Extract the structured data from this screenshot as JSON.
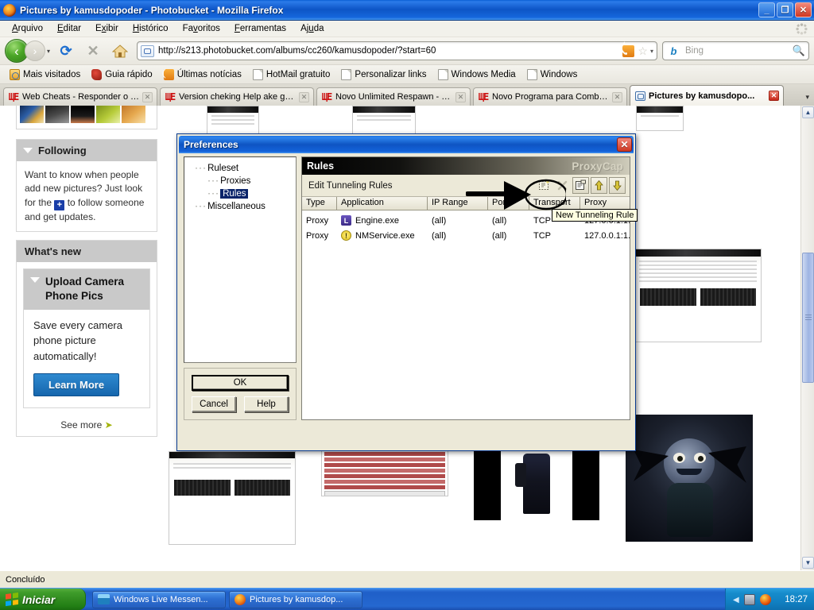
{
  "browser": {
    "window_title": "Pictures by kamusdopoder - Photobucket - Mozilla Firefox",
    "icon": "firefox-icon",
    "window_buttons": {
      "minimize": "_",
      "maximize": "❐",
      "close": "✕"
    },
    "menu": [
      {
        "label": "Arquivo",
        "accel": "A"
      },
      {
        "label": "Editar",
        "accel": "E"
      },
      {
        "label": "Exibir",
        "accel": "x"
      },
      {
        "label": "Histórico",
        "accel": "H"
      },
      {
        "label": "Favoritos",
        "accel": "v"
      },
      {
        "label": "Ferramentas",
        "accel": "F"
      },
      {
        "label": "Ajuda",
        "accel": "u"
      }
    ],
    "toolbar": {
      "back": "‹",
      "forward": "›",
      "history_caret": "▾",
      "reload": "⟳",
      "stop": "✕",
      "home": "home-icon",
      "url": "http://s213.photobucket.com/albums/cc260/kamusdopoder/?start=60",
      "rss": "rss-icon",
      "star": "☆",
      "bookmark_caret": "▾",
      "search_engine": "b",
      "search_placeholder": "Bing",
      "search_value": "",
      "search_icon": "magnifier-icon"
    },
    "bookmarks": [
      {
        "label": "Mais visitados",
        "icon": "folder-search-icon"
      },
      {
        "label": "Guia rápido",
        "icon": "red-bookmark-icon"
      },
      {
        "label": "Últimas notícias",
        "icon": "rss-icon"
      },
      {
        "label": "HotMail gratuito",
        "icon": "page-icon"
      },
      {
        "label": "Personalizar links",
        "icon": "page-icon"
      },
      {
        "label": "Windows Media",
        "icon": "page-icon"
      },
      {
        "label": "Windows",
        "icon": "page-icon"
      }
    ],
    "tabs": [
      {
        "label": "Web Cheats - Responder o T...",
        "icon": "wc-icon",
        "active": false
      },
      {
        "label": "Version cheking Help ake gen...",
        "icon": "wc-icon",
        "active": false
      },
      {
        "label": "Novo Unlimited Respawn - W...",
        "icon": "wc-icon",
        "active": false
      },
      {
        "label": "Novo Programa para Combat...",
        "icon": "wc-icon",
        "active": false
      },
      {
        "label": "Pictures by kamusdopo...",
        "icon": "photobucket-icon",
        "active": true
      }
    ],
    "tab_close_glyph": "✕",
    "tabs_overflow_caret": "▾",
    "status_text": "Concluído",
    "scrollbar": {
      "up": "▲",
      "down": "▼"
    }
  },
  "page": {
    "following": {
      "header": "Following",
      "collapse_icon": "triangle-down-icon",
      "body_before": "Want to know when people add new pictures? Just look for the",
      "badge": "+",
      "body_after": "to follow someone and get updates."
    },
    "whats_new": {
      "header": "What's new",
      "card_title": "Upload Camera Phone Pics",
      "collapse_icon": "triangle-down-icon",
      "card_text": "Save every camera phone picture automatically!",
      "cta": "Learn More",
      "see_more": "See more",
      "see_more_icon": "arrow-right-icon"
    }
  },
  "dialog": {
    "title": "Preferences",
    "close_glyph": "✕",
    "tree": [
      {
        "label": "Ruleset",
        "depth": 0,
        "selected": false
      },
      {
        "label": "Proxies",
        "depth": 1,
        "selected": false
      },
      {
        "label": "Rules",
        "depth": 1,
        "selected": true
      },
      {
        "label": "Miscellaneous",
        "depth": 0,
        "selected": false
      }
    ],
    "buttons": {
      "ok": "OK",
      "cancel": "Cancel",
      "help": "Help"
    },
    "panel": {
      "header": "Rules",
      "brand": "ProxyCap",
      "subheader": "Edit Tunneling Rules",
      "toolbar_buttons": [
        {
          "name": "new-tunneling-rule-button",
          "icon": "new-rule-icon"
        },
        {
          "name": "delete-rule-button",
          "icon": "delete-x-icon"
        },
        {
          "name": "edit-rule-button",
          "icon": "properties-icon"
        },
        {
          "name": "move-up-button",
          "icon": "arrow-up-icon"
        },
        {
          "name": "move-down-button",
          "icon": "arrow-down-icon"
        }
      ],
      "tooltip": "New Tunneling Rule",
      "columns": [
        "Type",
        "Application",
        "IP Range",
        "Ports",
        "Transport",
        "Proxy"
      ],
      "rows": [
        {
          "type": "Proxy",
          "application": "Engine.exe",
          "app_icon": "engine-icon",
          "ip_range": "(all)",
          "ports": "(all)",
          "transport": "TCP",
          "proxy": "127.0.0.1:1..."
        },
        {
          "type": "Proxy",
          "application": "NMService.exe",
          "app_icon": "warning-icon",
          "ip_range": "(all)",
          "ports": "(all)",
          "transport": "TCP",
          "proxy": "127.0.0.1:1..."
        }
      ]
    }
  },
  "taskbar": {
    "start_label": "Iniciar",
    "start_icon": "windows-logo-icon",
    "tasks": [
      {
        "label": "Windows Live Messen...",
        "icon": "messenger-icon"
      },
      {
        "label": "Pictures by kamusdop...",
        "icon": "firefox-icon"
      }
    ],
    "tray": {
      "expand_icon": "chevron-left-icon",
      "icons": [
        "network-icon",
        "firefox-icon"
      ],
      "clock": "18:27"
    }
  },
  "colors": {
    "titlebar_blue": "#0d55c6",
    "dialog_face": "#ece9d8",
    "selection_blue": "#0a246a",
    "start_green": "#2f8a1e",
    "learn_more_blue": "#1666ad"
  }
}
